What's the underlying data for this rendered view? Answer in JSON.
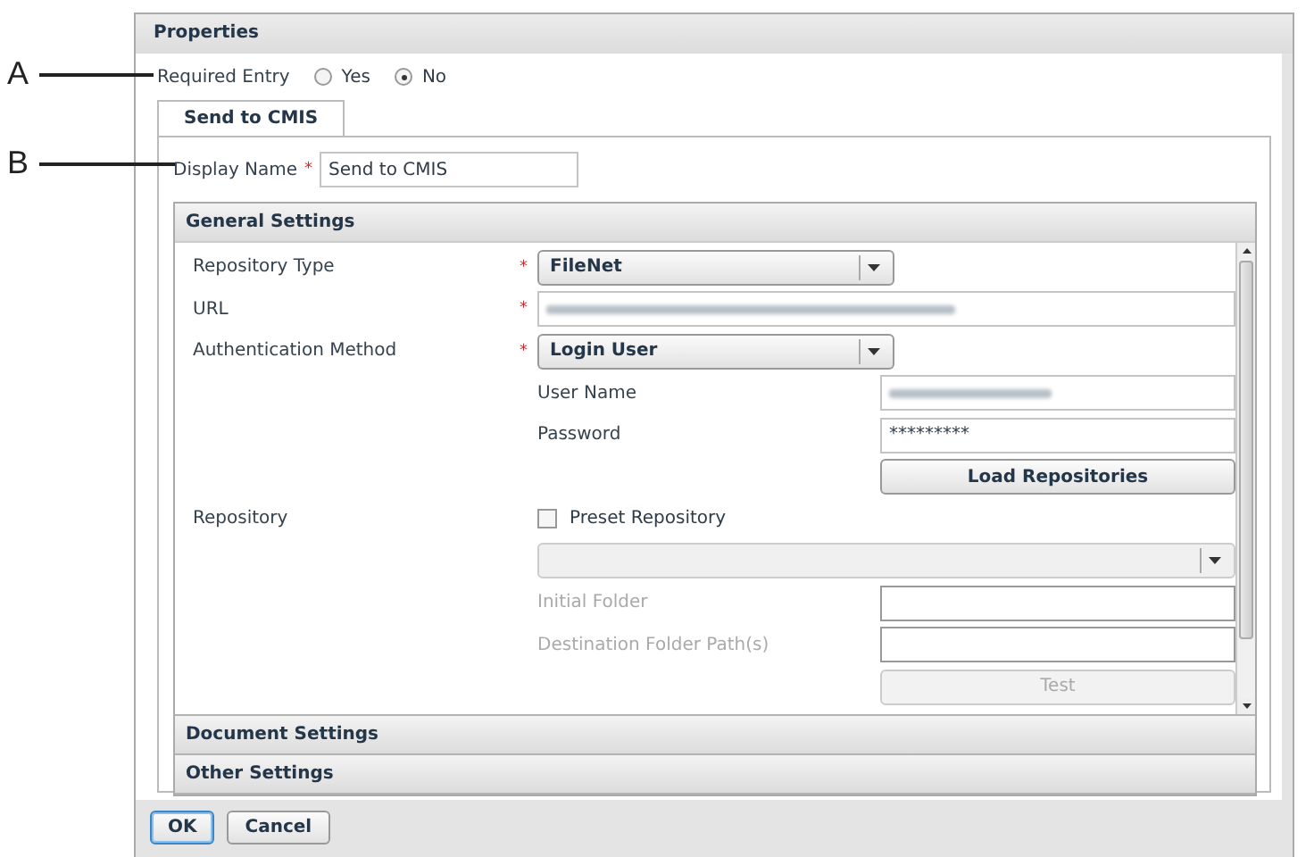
{
  "title": "Properties",
  "required_entry": {
    "label": "Required Entry",
    "options": [
      {
        "label": "Yes",
        "selected": false
      },
      {
        "label": "No",
        "selected": true
      }
    ]
  },
  "tabs": [
    {
      "label": "Send to CMIS",
      "selected": true
    }
  ],
  "display_name": {
    "label": "Display Name",
    "marker": "*",
    "value": "Send to CMIS"
  },
  "sections": [
    {
      "title": "General Settings",
      "expanded": true
    },
    {
      "title": "Document Settings",
      "expanded": false
    },
    {
      "title": "Other Settings",
      "expanded": false
    }
  ],
  "general_rows": [
    {
      "kind": "select",
      "label": "Repository Type",
      "marker": "*",
      "value": "FileNet"
    },
    {
      "kind": "blurred",
      "label": "URL",
      "marker": "*"
    },
    {
      "kind": "select",
      "label": "Authentication Method",
      "marker": "*",
      "value": "Login User"
    },
    {
      "kind": "subfield",
      "label": "User Name",
      "blurred": true,
      "disabled": false
    },
    {
      "kind": "subfield",
      "label": "Password",
      "value": "*********",
      "blurred": false,
      "disabled": false
    },
    {
      "kind": "subbutton",
      "label": "Load Repositories",
      "disabled": false
    },
    {
      "kind": "checkbox",
      "label": "Repository",
      "option": "Preset Repository",
      "checked": false
    },
    {
      "kind": "subselect",
      "disabled": true
    },
    {
      "kind": "subfield",
      "label": "Initial Folder",
      "blurred": false,
      "disabled": true
    },
    {
      "kind": "subfield",
      "label": "Destination Folder Path(s)",
      "blurred": false,
      "disabled": true
    },
    {
      "kind": "subbutton",
      "label": "Test",
      "disabled": true
    }
  ],
  "buttons": [
    {
      "label": "OK",
      "default": true
    },
    {
      "label": "Cancel",
      "default": false
    }
  ],
  "callouts": [
    {
      "letter": "A"
    },
    {
      "letter": "B"
    }
  ]
}
